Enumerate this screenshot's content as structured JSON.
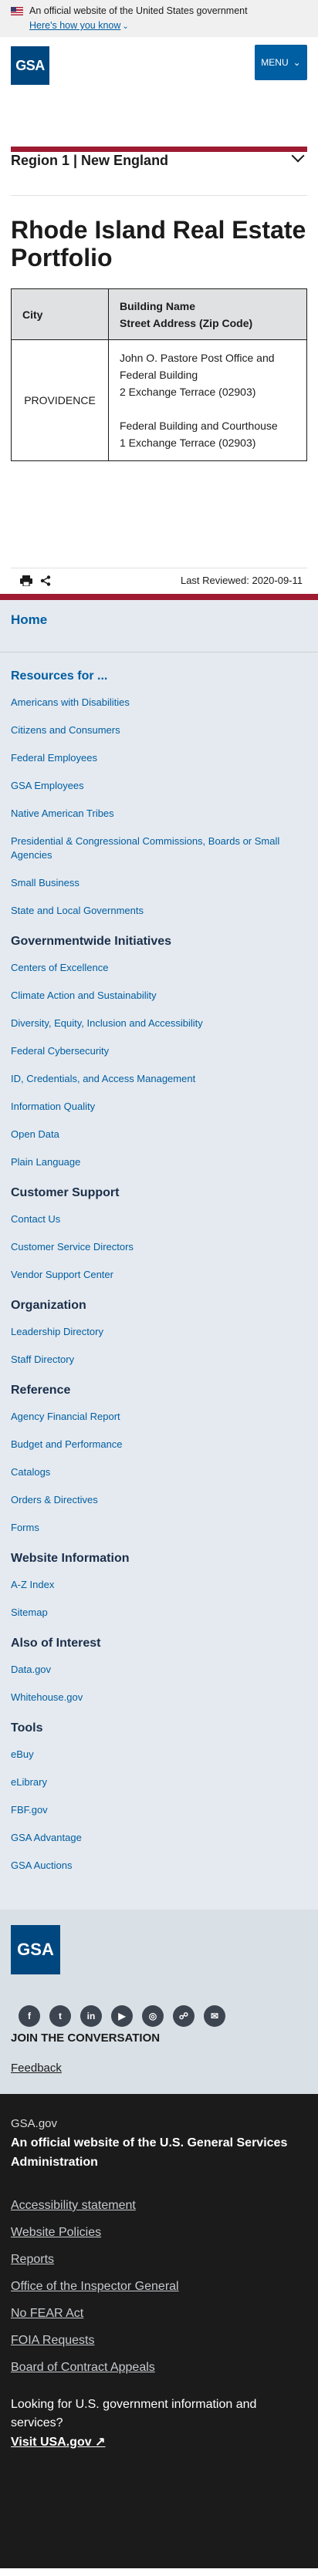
{
  "banner": {
    "official_text": "An official website of the United States government",
    "how_know": "Here's how you know"
  },
  "header": {
    "logo_text": "GSA",
    "menu_label": "MENU"
  },
  "region": {
    "title": "Region 1 | New England"
  },
  "page": {
    "title": "Rhode Island Real Estate Portfolio"
  },
  "table": {
    "headers": {
      "city": "City",
      "building_name": "Building Name",
      "street_address": "Street Address (Zip Code)"
    },
    "rows": [
      {
        "city": "PROVIDENCE",
        "buildings": [
          {
            "name": "John O. Pastore Post Office and Federal Building",
            "address": "2 Exchange Terrace (02903)"
          },
          {
            "name": "Federal Building and Courthouse",
            "address": "1 Exchange Terrace (02903)"
          }
        ]
      }
    ]
  },
  "share": {
    "last_reviewed": "Last Reviewed: 2020-09-11"
  },
  "footer": {
    "home": "Home",
    "sections": [
      {
        "heading": "Resources for ...",
        "items": [
          "Americans with Disabilities",
          "Citizens and Consumers",
          "Federal Employees",
          "GSA Employees",
          "Native American Tribes",
          "Presidential & Congressional Commissions, Boards or Small Agencies",
          "Small Business",
          "State and Local Governments"
        ]
      },
      {
        "heading": "Governmentwide Initiatives",
        "items": [
          "Centers of Excellence",
          "Climate Action and Sustainability",
          "Diversity, Equity, Inclusion and Accessibility",
          "Federal Cybersecurity",
          "ID, Credentials, and Access Management",
          "Information Quality",
          "Open Data",
          "Plain Language"
        ]
      },
      {
        "heading": "Customer Support",
        "items": [
          "Contact Us",
          "Customer Service Directors",
          "Vendor Support Center"
        ]
      },
      {
        "heading": "Organization",
        "items": [
          "Leadership Directory",
          "Staff Directory"
        ]
      },
      {
        "heading": "Reference",
        "items": [
          "Agency Financial Report",
          "Budget and Performance",
          "Catalogs",
          "Orders & Directives",
          "Forms"
        ]
      },
      {
        "heading": "Website Information",
        "items": [
          "A-Z Index",
          "Sitemap"
        ]
      },
      {
        "heading": "Also of Interest",
        "items": [
          "Data.gov",
          "Whitehouse.gov"
        ]
      },
      {
        "heading": "Tools",
        "items": [
          "eBuy",
          "eLibrary",
          "FBF.gov",
          "GSA Advantage",
          "GSA Auctions"
        ]
      }
    ],
    "logo_text": "GSA",
    "social": [
      "f",
      "t",
      "in",
      "▶",
      "◎",
      "☍",
      "✉"
    ],
    "join": "JOIN THE CONVERSATION",
    "feedback": "Feedback"
  },
  "identifier": {
    "domain": "GSA.gov",
    "title": "An official website of the U.S. General Services Administration",
    "links": [
      "Accessibility statement",
      "Website Policies",
      "Reports",
      "Office of the Inspector General",
      "No FEAR Act",
      "FOIA Requests",
      "Board of Contract Appeals"
    ],
    "usa_text": "Looking for U.S. government information and services?",
    "visit": "Visit USA.gov"
  }
}
